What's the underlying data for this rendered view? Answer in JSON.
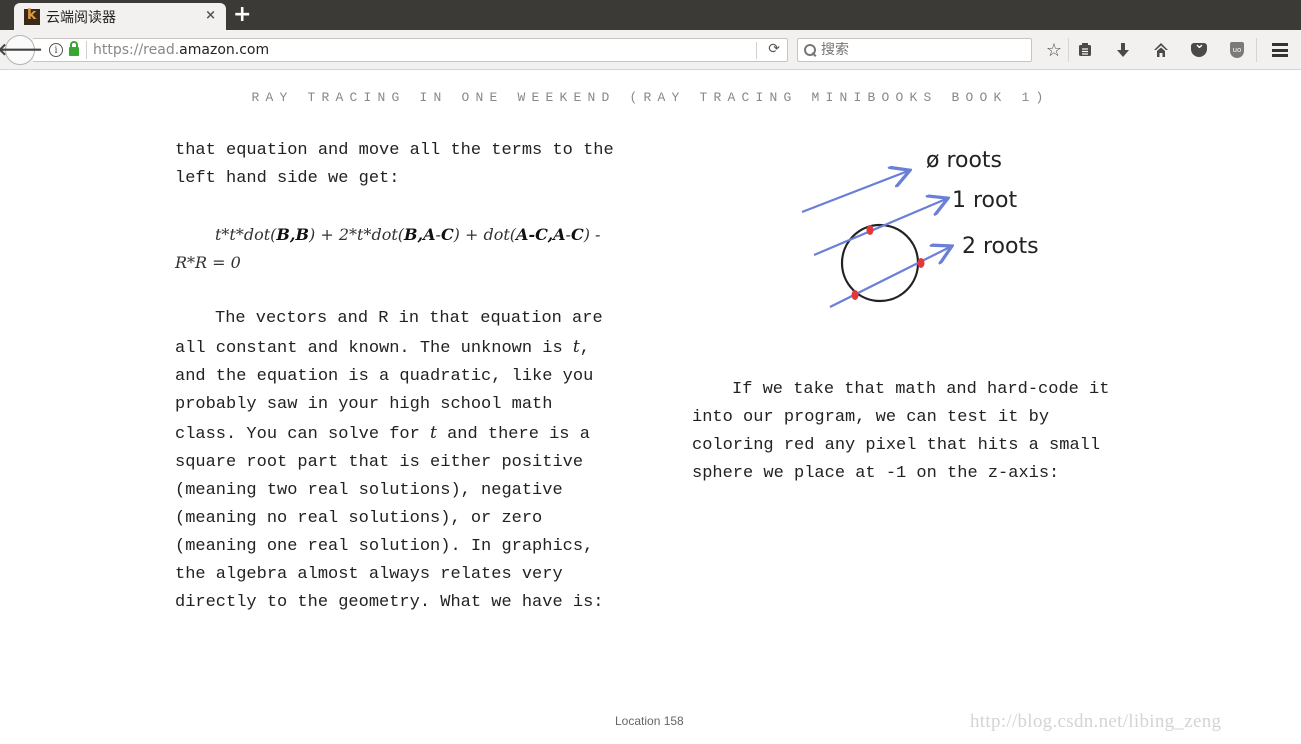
{
  "browser": {
    "tab": {
      "title": "云端阅读器",
      "favicon": "kindle-k-icon",
      "close": "×"
    },
    "new_tab": "+",
    "url": {
      "prefix": "https://read.",
      "domain": "amazon.com"
    },
    "search": {
      "placeholder": "搜索",
      "value": ""
    },
    "toolbar_icons": [
      "bookmark-star-icon",
      "reading-list-icon",
      "downloads-icon",
      "home-icon",
      "pocket-icon",
      "ublock-icon",
      "menu-icon"
    ]
  },
  "reader": {
    "book_title": "RAY TRACING IN ONE WEEKEND (RAY TRACING MINIBOOKS BOOK 1)",
    "left_column": {
      "p1": "that equation and move all the terms to the left hand side we get:",
      "equation": {
        "part1": "t*t*dot(",
        "b1": "B,B",
        "part2": ") + 2*t*dot(",
        "b2": "B,A",
        "part3": "-",
        "b3": "C",
        "part4": ") + dot(",
        "b4": "A-",
        "b5": "C,A",
        "part5": "-",
        "b6": "C",
        "part6": ") - R*R = 0"
      },
      "p3_a": "The vectors and R in that equation are all constant and known. The unknown is ",
      "p3_var1": "t",
      "p3_b": ", and the equation is a quadratic, like you probably saw in your high school math class. You can solve for ",
      "p3_var2": "t",
      "p3_c": " and there is a square root part that is either positive (meaning two real solutions), negative (meaning no real solutions), or zero (meaning one real solution). In graphics, the algebra almost always relates very directly to the geometry. What we have is:"
    },
    "figure": {
      "labels": [
        "ø roots",
        "1 root",
        "2 roots"
      ],
      "ray_color": "#6a7fd8",
      "hit_color": "#e0393a"
    },
    "right_column": {
      "p1": "If we take that math and hard-code it into our program, we can test it by coloring red any pixel that hits a small sphere we place at -1 on the z-axis:"
    },
    "location": "Location 158"
  },
  "watermark": "http://blog.csdn.net/libing_zeng"
}
